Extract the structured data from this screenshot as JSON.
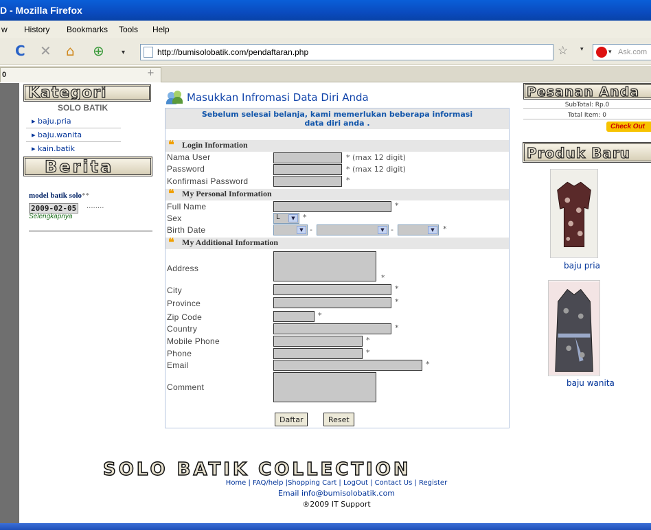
{
  "browser": {
    "title": "D - Mozilla Firefox",
    "menu": [
      "w",
      "History",
      "Bookmarks",
      "Tools",
      "Help"
    ],
    "url": "http://bumisolobatik.com/pendaftaran.php",
    "search_placeholder": "Ask.com",
    "tab_label": "0",
    "newtab": "+"
  },
  "left": {
    "kategori_title": "Kategori",
    "store_name": "SOLO BATIK",
    "links": [
      "baju.pria",
      "baju.wanita",
      "kain.batik"
    ],
    "berita_title": "Berita",
    "news_title": "model batik solo",
    "news_marks": "**",
    "news_date": "2009-02-05",
    "news_dots": "........",
    "more": "Selengkapnya"
  },
  "form": {
    "heading": "Masukkan Infromasi Data Diri Anda",
    "intro": "Sebelum selesai belanja, kami memerlukan beberapa informasi data diri anda .",
    "sections": {
      "login": "Login Information",
      "personal": "My Personal Information",
      "additional": "My Additional Information"
    },
    "labels": {
      "username": "Nama User",
      "password": "Password",
      "confirm": "Konfirmasi Password",
      "fullname": "Full Name",
      "sex": "Sex",
      "birth": "Birth Date",
      "address": "Address",
      "city": "City",
      "province": "Province",
      "zip": "Zip Code",
      "country": "Country",
      "mobile": "Mobile Phone",
      "phone": "Phone",
      "email": "Email",
      "comment": "Comment"
    },
    "max_note": "* (max 12 digit)",
    "required": "*",
    "dash": "-",
    "sex_value": "L",
    "buttons": {
      "submit": "Daftar",
      "reset": "Reset"
    }
  },
  "right": {
    "cart_title": "Pesanan Anda",
    "subtotal": "SubTotal: Rp.0",
    "total_items": "Total Item: 0",
    "checkout": "Check Out",
    "new_products_title": "Produk Baru",
    "products": [
      "baju pria",
      "baju wanita"
    ]
  },
  "footer": {
    "banner": "SOLO BATIK  COLLECTION",
    "links": "Home | FAQ/help |Shopping Cart | LogOut | Contact Us | Register",
    "email": "Email info@bumisolobatik.com",
    "copyright": "®2009 IT Support"
  }
}
